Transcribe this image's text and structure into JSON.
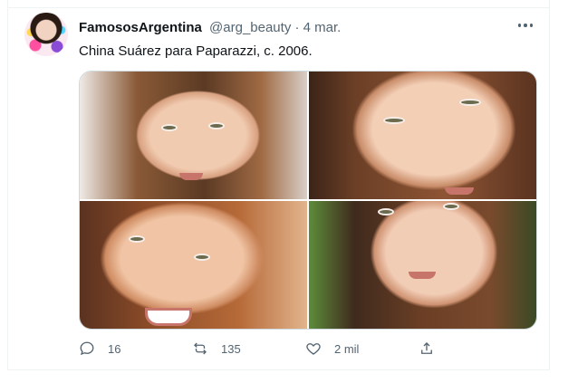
{
  "tweet": {
    "author_name": "FamososArgentina",
    "handle": "@arg_beauty",
    "separator": "·",
    "date": "4 mar.",
    "text": "China Suárez para Paparazzi, c. 2006.",
    "more_icon": "more-horizontal-icon",
    "photos": [
      {
        "icon": "photo-1"
      },
      {
        "icon": "photo-2"
      },
      {
        "icon": "photo-3"
      },
      {
        "icon": "photo-4"
      }
    ],
    "actions": {
      "replies": "16",
      "retweets": "135",
      "likes": "2 mil"
    }
  },
  "colors": {
    "text_primary": "#0f1419",
    "text_secondary": "#536471",
    "border": "#eff3f4"
  }
}
